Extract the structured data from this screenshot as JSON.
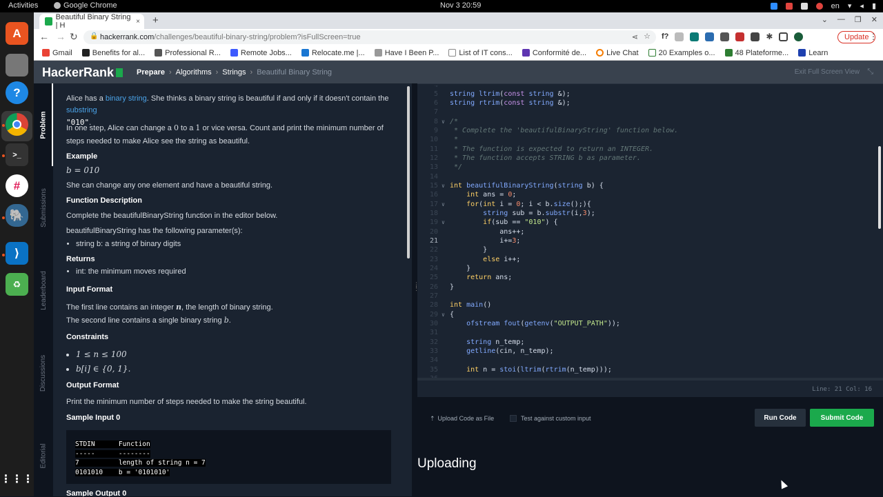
{
  "os": {
    "activities": "Activities",
    "app_name": "Google Chrome",
    "clock": "Nov 3  20:59",
    "lang": "en"
  },
  "dock": {
    "items": [
      "app-center-icon",
      "files-icon",
      "help-icon",
      "chrome-icon",
      "terminal-icon",
      "slack-icon",
      "postgres-icon",
      "vscode-icon",
      "trash-icon",
      "app-grid-icon"
    ]
  },
  "browser": {
    "tab_title": "Beautiful Binary String | H",
    "tab_close": "×",
    "new_tab": "+",
    "url_domain": "hackerrank.com",
    "url_path": "/challenges/beautiful-binary-string/problem?isFullScreen=true",
    "update_label": "Update",
    "bookmarks": [
      "Gmail",
      "Benefits for al...",
      "Professional R...",
      "Remote Jobs...",
      "Relocate.me |...",
      "Have I Been P...",
      "List of IT cons...",
      "Conformité de...",
      "Live Chat",
      "20 Examples o...",
      "48 Plateforme...",
      "Learn"
    ]
  },
  "header": {
    "logo": "HackerRank",
    "crumbs": [
      "Prepare",
      "Algorithms",
      "Strings",
      "Beautiful Binary String"
    ],
    "exit_fullscreen": "Exit Full Screen View"
  },
  "sidetabs": [
    "Problem",
    "Submissions",
    "Leaderboard",
    "Discussions",
    "Editorial"
  ],
  "problem": {
    "intro_1": "Alice has a ",
    "intro_link_1": "binary string",
    "intro_2": ". She thinks a binary string is beautiful if and only if it doesn't contain the ",
    "intro_link_2": "substring",
    "intro_code": "\"010\"",
    "step_text_a": "In one step, Alice can change a ",
    "step_zero": "0",
    "step_text_b": " to a ",
    "step_one": "1",
    "step_text_c": " or vice versa. Count and print the minimum number of steps needed to make Alice see the string as beautiful.",
    "example_h": "Example",
    "example_math": "b = 010",
    "example_text": "She can change any one element and have a beautiful string.",
    "funcdesc_h": "Function Description",
    "funcdesc_text": "Complete the beautifulBinaryString function in the editor below.",
    "params_text": "beautifulBinaryString has the following parameter(s):",
    "param_1": "string b: a string of binary digits",
    "returns_h": "Returns",
    "return_1": "int: the minimum moves required",
    "input_h": "Input Format",
    "input_1a": "The first line contains an integer ",
    "input_1_var": "n",
    "input_1b": ", the length of binary string.",
    "input_2a": "The second line contains a single binary string ",
    "input_2_var": "b",
    "input_2b": ".",
    "constraints_h": "Constraints",
    "constraint_1": "1 ≤ n ≤ 100",
    "constraint_2": "b[i] ∈ {0, 1}.",
    "output_h": "Output Format",
    "output_text": "Print the minimum number of steps needed to make the string beautiful.",
    "sample_in_h": "Sample Input 0",
    "sample_lines": [
      "STDIN      Function",
      "-----      --------",
      "7          length of string n = 7",
      "0101010    b = '0101010'"
    ],
    "sample_out_h": "Sample Output 0"
  },
  "editor": {
    "status": "Line: 21 Col: 16",
    "current_line": 21
  },
  "actions": {
    "upload_label": "Upload Code as File",
    "custom_label": "Test against custom input",
    "run_label": "Run Code",
    "submit_label": "Submit Code",
    "uploading": "Uploading"
  },
  "colors": {
    "hr_green": "#1ba94c",
    "panel_bg": "#1a2330",
    "page_bg": "#0e141e",
    "header_bg": "#39424e"
  }
}
